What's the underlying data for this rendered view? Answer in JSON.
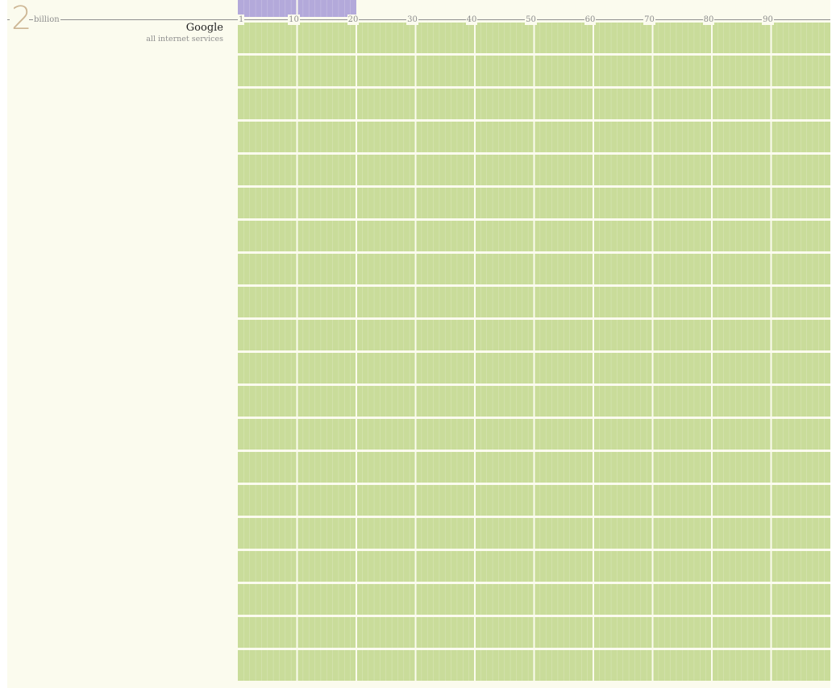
{
  "chart_data": {
    "type": "bar",
    "title": "",
    "scale": {
      "number": "2",
      "unit": "billion"
    },
    "company": {
      "name": "Google",
      "subtitle": "all internet services"
    },
    "x_ticks": [
      "1",
      "10",
      "20",
      "30",
      "40",
      "50",
      "60",
      "70",
      "80",
      "90"
    ],
    "xlim": [
      1,
      100
    ],
    "series": [
      {
        "filled_rows": 20,
        "color": "#c9dc9a"
      },
      {
        "partial_row_length": 20,
        "color": "#b3a9da"
      }
    ],
    "grid": true
  }
}
